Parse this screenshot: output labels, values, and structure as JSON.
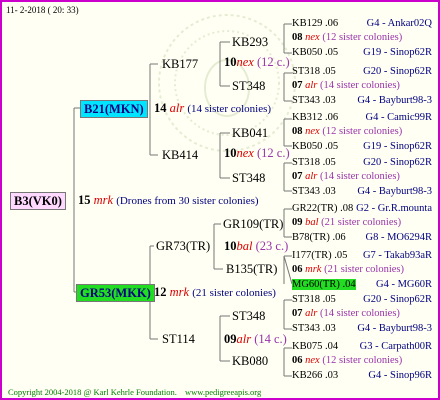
{
  "header": {
    "date": "11-  2-2018  ( 20: 33)"
  },
  "footer": {
    "copyright": "Copyright 2004-2018 @ Karl Kehrle Foundation.",
    "website": "www.pedigreeapis.org"
  },
  "root": {
    "label": "B3(VK0)"
  },
  "gen1": [
    {
      "count": "15",
      "abbr": "mrk",
      "note": "(Drones from 30 sister colonies)"
    }
  ],
  "queens": {
    "b21": {
      "label": "B21(MKN)",
      "count": "14",
      "abbr": "alr",
      "note": "(14 sister colonies)",
      "color": "#00e5ff"
    },
    "gr53": {
      "label": "GR53(MKK)",
      "count": "12",
      "abbr": "mrk",
      "note": "(21 sister colonies)",
      "color": "#22dd22"
    }
  },
  "level3": [
    {
      "label": "KB177"
    },
    {
      "label": "KB414"
    },
    {
      "label": "GR73(TR)"
    },
    {
      "label": "ST114"
    }
  ],
  "level4": [
    {
      "label": "KB293",
      "count": "10",
      "abbr": "nex",
      "note": "(12 c.)"
    },
    {
      "label": "ST348",
      "count": "",
      "abbr": "",
      "note": ""
    },
    {
      "label": "KB041",
      "count": "",
      "abbr": "",
      "note": ""
    },
    {
      "label": "KB414",
      "count": "10",
      "abbr": "nex",
      "note": "(12 c.)"
    },
    {
      "label": "ST348",
      "count": "",
      "abbr": "",
      "note": ""
    },
    {
      "label": "GR109(TR)",
      "count": "",
      "abbr": "",
      "note": ""
    },
    {
      "label": "B135(TR)",
      "count": "10",
      "abbr": "bal",
      "note": "(23 c.)"
    },
    {
      "label": "ST348",
      "count": "",
      "abbr": "",
      "note": ""
    },
    {
      "label": "KB080",
      "count": "09",
      "abbr": "alr",
      "note": "(14 c.)"
    }
  ],
  "leaves": [
    {
      "left": "KB129 .06",
      "right": "G4 - Ankar02Q"
    },
    {
      "count": "08",
      "abbr": "nex",
      "note": "(12 sister colonies)"
    },
    {
      "left": "KB050 .05",
      "right": "G19 - Sinop62R"
    },
    {
      "left": "ST318 .05",
      "right": "G20 - Sinop62R"
    },
    {
      "count": "07",
      "abbr": "alr",
      "note": "(14 sister colonies)"
    },
    {
      "left": "ST343 .03",
      "right": "G4 - Bayburt98-3"
    },
    {
      "left": "KB312 .06",
      "right": "G4 - Camic99R"
    },
    {
      "count": "08",
      "abbr": "nex",
      "note": "(12 sister colonies)"
    },
    {
      "left": "KB050 .05",
      "right": "G19 - Sinop62R"
    },
    {
      "left": "ST318 .05",
      "right": "G20 - Sinop62R"
    },
    {
      "count": "07",
      "abbr": "alr",
      "note": "(14 sister colonies)"
    },
    {
      "left": "ST343 .03",
      "right": "G4 - Bayburt98-3"
    },
    {
      "left": "GR22(TR) .08",
      "right": "G2 - Gr.R.mounta"
    },
    {
      "count": "09",
      "abbr": "bal",
      "note": "(21 sister colonies)"
    },
    {
      "left": "B78(TR) .06",
      "right": "G8 - MO6294R"
    },
    {
      "left": "I177(TR) .05",
      "right": "G7 - Takab93aR"
    },
    {
      "count": "06",
      "abbr": "mrk",
      "note": "(21 sister colonies)"
    },
    {
      "left": "MG60(TR) .04",
      "right": "G4 - MG60R"
    },
    {
      "left": "ST318 .05",
      "right": "G20 - Sinop62R"
    },
    {
      "count": "07",
      "abbr": "alr",
      "note": "(14 sister colonies)"
    },
    {
      "left": "ST343 .03",
      "right": "G4 - Bayburt98-3"
    },
    {
      "left": "KB075 .04",
      "right": "G3 - Carpath00R"
    },
    {
      "count": "06",
      "abbr": "nex",
      "note": "(12 sister colonies)"
    },
    {
      "left": "KB266 .03",
      "right": "G4 - Sinop96R"
    }
  ]
}
